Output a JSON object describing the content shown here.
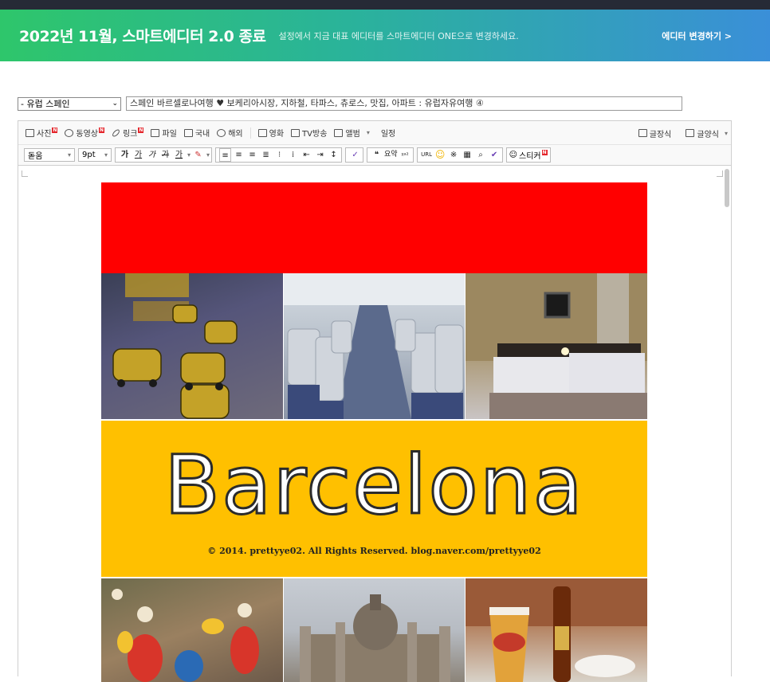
{
  "banner": {
    "title": "2022년 11월, 스마트에디터 2.0 종료",
    "subtitle": "설정에서 지금 대표 에디터를 스마트에디터 ONE으로 변경하세요.",
    "link": "에디터 변경하기 >"
  },
  "post": {
    "category": "- 유럽 스페인",
    "title": "스페인 바르셀로나여행 ♥ 보케리아시장, 지하철, 타파스, 츄로스, 맛집, 아파트 : 유럽자유여행 ④"
  },
  "toolbar_top": {
    "items": [
      {
        "label": "사진",
        "icon": "camera-icon",
        "new": true
      },
      {
        "label": "동영상",
        "icon": "play-icon",
        "new": true
      },
      {
        "label": "링크",
        "icon": "link-icon",
        "new": true
      },
      {
        "label": "파일",
        "icon": "file-icon",
        "new": false
      },
      {
        "label": "국내",
        "icon": "map-icon",
        "new": false
      },
      {
        "label": "해외",
        "icon": "globe-icon",
        "new": false
      },
      {
        "label": "영화",
        "icon": "film-icon",
        "new": false
      },
      {
        "label": "TV방송",
        "icon": "tv-icon",
        "new": false
      },
      {
        "label": "앨범",
        "icon": "album-icon",
        "new": false
      },
      {
        "label": "일정",
        "icon": "calendar-icon",
        "new": false
      }
    ],
    "right": [
      {
        "label": "글장식",
        "icon": "pencil-icon"
      },
      {
        "label": "글양식",
        "icon": "template-icon"
      }
    ],
    "new_badge": "N"
  },
  "toolbar_format": {
    "font": "돋움",
    "size": "9pt",
    "bold": "가",
    "underline": "가",
    "italic": "가",
    "strike": "가",
    "color": "가",
    "quote": "❝",
    "summary": "요약",
    "superscript": "ᵡᵃ²",
    "url": "URL",
    "sticker": "스티커"
  },
  "content": {
    "banner_text": "Barcelona",
    "copyright": "© 2014. prettyye02. All Rights Reserved. blog.naver.com/prettyye02"
  },
  "colors": {
    "accent_red": "#ff0000",
    "accent_yellow": "#ffc000",
    "banner_green": "#2ec66b",
    "banner_blue": "#3a8fd8"
  }
}
